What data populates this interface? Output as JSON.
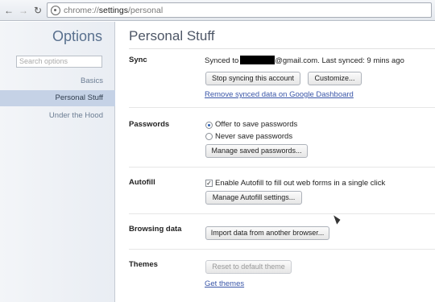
{
  "toolbar": {
    "url_scheme": "chrome://",
    "url_host": "settings",
    "url_path": "/personal"
  },
  "sidebar": {
    "title": "Options",
    "search_placeholder": "Search options",
    "items": [
      {
        "label": "Basics"
      },
      {
        "label": "Personal Stuff"
      },
      {
        "label": "Under the Hood"
      }
    ]
  },
  "main": {
    "title": "Personal Stuff",
    "sync": {
      "label": "Sync",
      "status_prefix": "Synced to",
      "status_suffix": "@gmail.com. Last synced: 9 mins ago",
      "stop_button": "Stop syncing this account",
      "customize_button": "Customize...",
      "remove_link": "Remove synced data on Google Dashboard"
    },
    "passwords": {
      "label": "Passwords",
      "option_offer": "Offer to save passwords",
      "option_never": "Never save passwords",
      "manage_button": "Manage saved passwords..."
    },
    "autofill": {
      "label": "Autofill",
      "enable_text": "Enable Autofill to fill out web forms in a single click",
      "manage_button": "Manage Autofill settings..."
    },
    "browsing": {
      "label": "Browsing data",
      "import_button": "Import data from another browser..."
    },
    "themes": {
      "label": "Themes",
      "reset_button": "Reset to default theme",
      "get_link": "Get themes"
    }
  }
}
